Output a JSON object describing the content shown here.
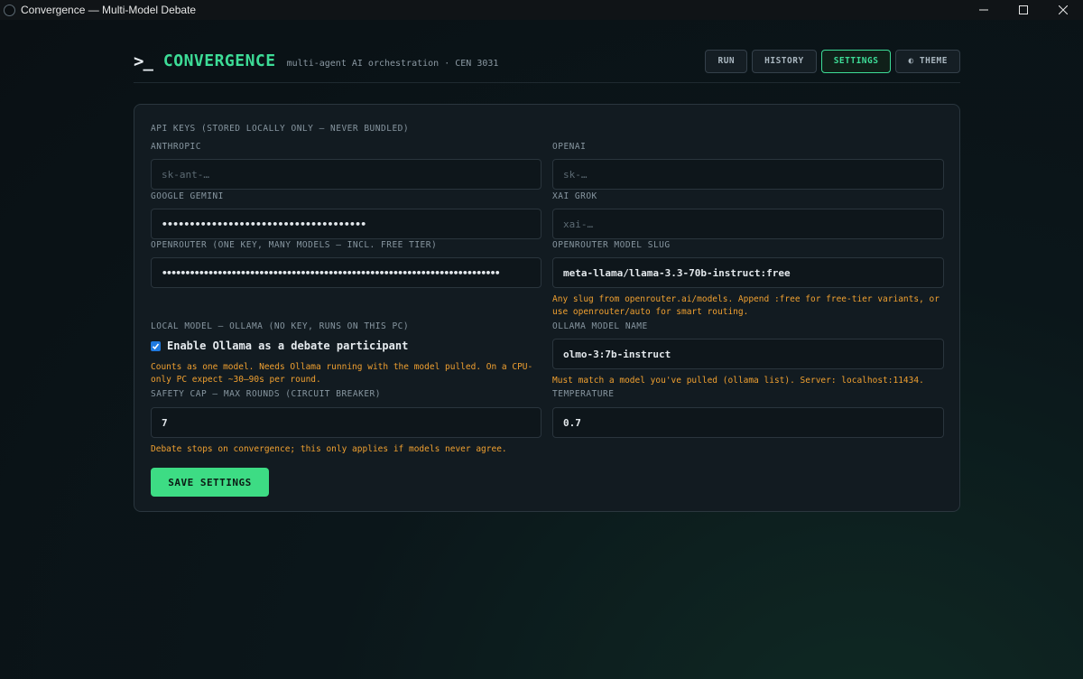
{
  "window": {
    "title": "Convergence — Multi-Model Debate"
  },
  "header": {
    "prompt": ">_",
    "brand": "CONVERGENCE",
    "tagline": "multi-agent AI orchestration · CEN 3031",
    "nav": {
      "run": "RUN",
      "history": "HISTORY",
      "settings": "SETTINGS",
      "theme": "◐ THEME"
    },
    "active_tab": "SETTINGS"
  },
  "settings": {
    "api_section_label": "API KEYS (STORED LOCALLY ONLY — NEVER BUNDLED)",
    "anthropic": {
      "label": "ANTHROPIC",
      "placeholder": "sk-ant-…",
      "value": ""
    },
    "openai": {
      "label": "OPENAI",
      "placeholder": "sk-…",
      "value": ""
    },
    "gemini": {
      "label": "GOOGLE GEMINI",
      "placeholder": "",
      "value": "•••••••••••••••••••••••••••••••••••••"
    },
    "grok": {
      "label": "XAI GROK",
      "placeholder": "xai-…",
      "value": ""
    },
    "openrouter": {
      "label": "OPENROUTER (ONE KEY, MANY MODELS — INCL. FREE TIER)",
      "placeholder": "",
      "value": "•••••••••••••••••••••••••••••••••••••••••••••••••••••••••••••••••••••••••"
    },
    "openrouter_slug": {
      "label": "OPENROUTER MODEL SLUG",
      "value": "meta-llama/llama-3.3-70b-instruct:free",
      "hint": "Any slug from openrouter.ai/models. Append :free for free-tier variants, or use openrouter/auto for smart routing."
    },
    "local_section_label": "LOCAL MODEL — OLLAMA (NO KEY, RUNS ON THIS PC)",
    "ollama_enable": {
      "label": "Enable Ollama as a debate participant",
      "checked": true,
      "hint": "Counts as one model. Needs Ollama running with the model pulled. On a CPU-only PC expect ~30–90s per round."
    },
    "ollama_model": {
      "label": "OLLAMA MODEL NAME",
      "value": "olmo-3:7b-instruct",
      "hint": "Must match a model you've pulled (ollama list). Server: localhost:11434."
    },
    "safety_cap": {
      "label": "SAFETY CAP — MAX ROUNDS (CIRCUIT BREAKER)",
      "value": "7",
      "hint": "Debate stops on convergence; this only applies if models never agree."
    },
    "temperature": {
      "label": "TEMPERATURE",
      "value": "0.7"
    },
    "save_label": "SAVE SETTINGS"
  },
  "colors": {
    "accent": "#3ddc97",
    "hint": "#f0a030",
    "save_button": "#3ddc84"
  }
}
